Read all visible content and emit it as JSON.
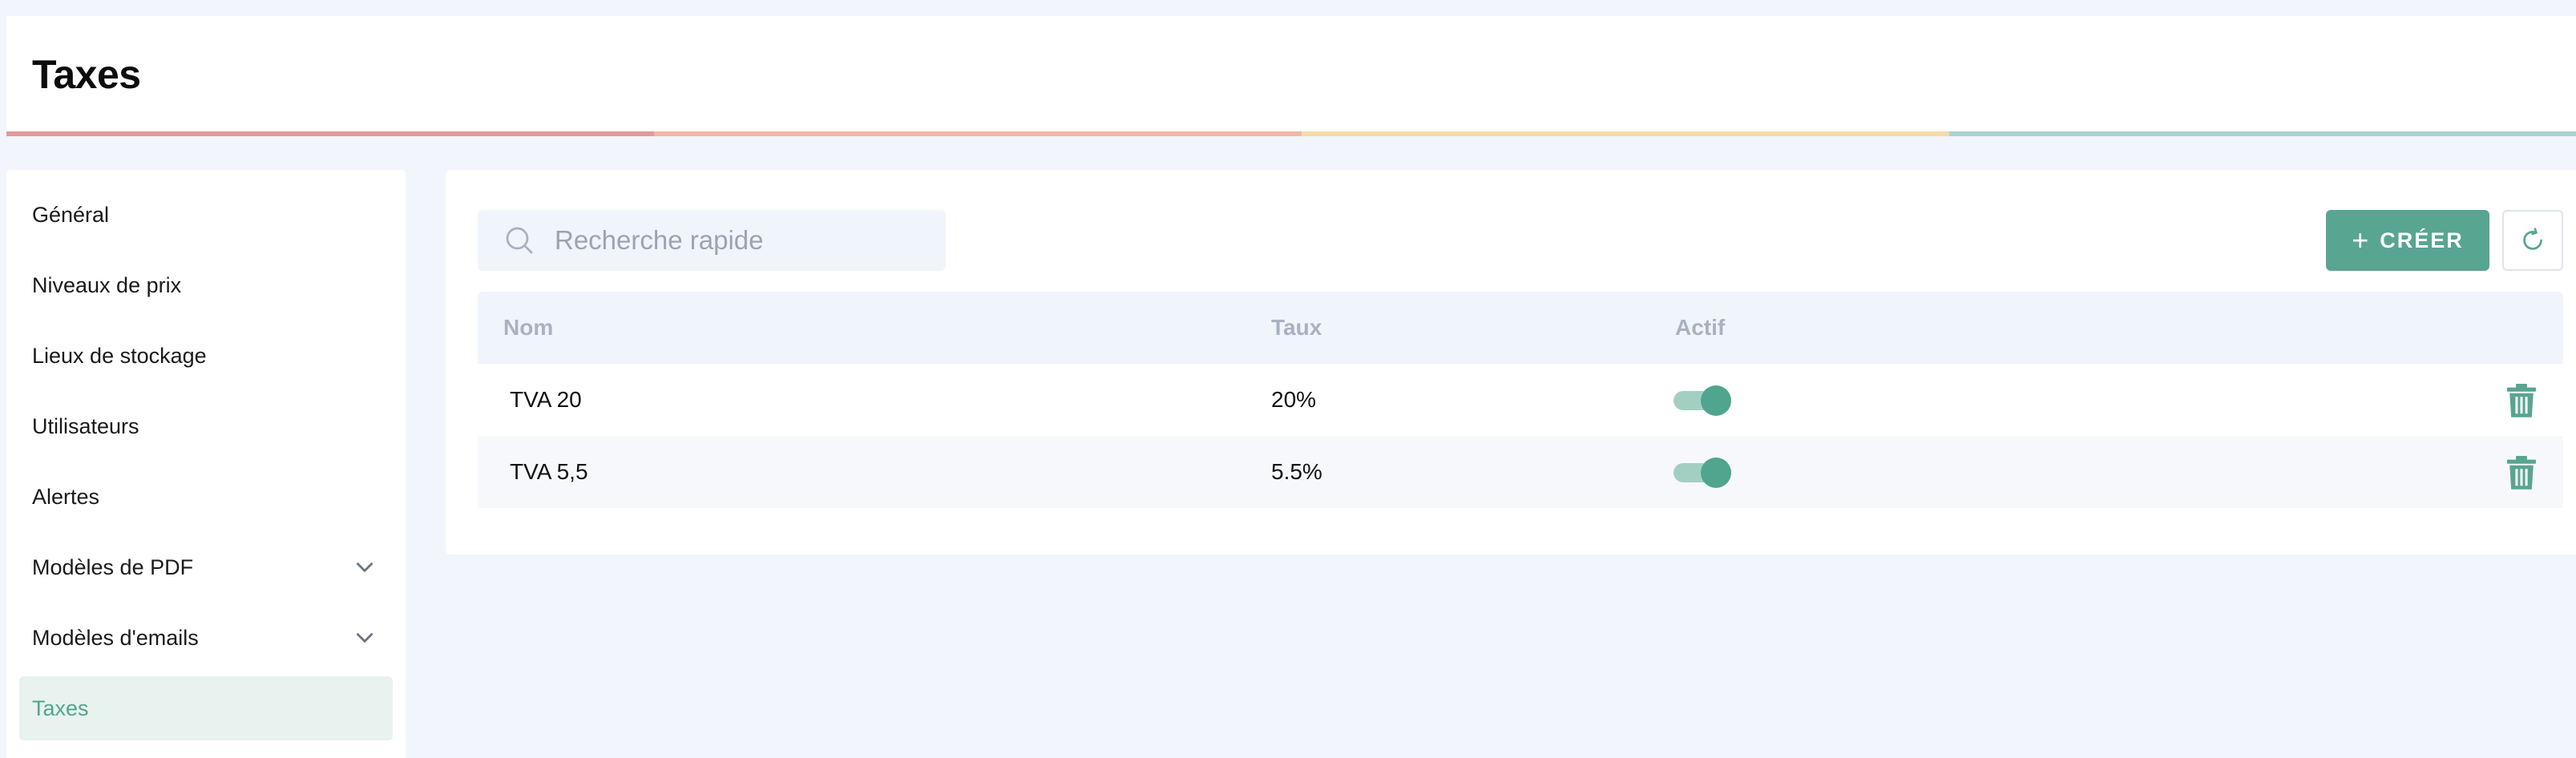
{
  "header": {
    "title": "Taxes"
  },
  "sidebar": {
    "items": [
      {
        "label": "Général"
      },
      {
        "label": "Niveaux de prix"
      },
      {
        "label": "Lieux de stockage"
      },
      {
        "label": "Utilisateurs"
      },
      {
        "label": "Alertes"
      },
      {
        "label": "Modèles de PDF",
        "expandable": true
      },
      {
        "label": "Modèles d'emails",
        "expandable": true
      },
      {
        "label": "Taxes",
        "active": true
      }
    ]
  },
  "toolbar": {
    "search_placeholder": "Recherche rapide",
    "search_icon": "search-icon",
    "create_label": "CRÉER",
    "create_icon": "plus-icon",
    "refresh_icon": "refresh-icon"
  },
  "table": {
    "columns": [
      "Nom",
      "Taux",
      "Actif"
    ],
    "rows": [
      {
        "name": "TVA 20",
        "rate": "20%",
        "active": true
      },
      {
        "name": "TVA 5,5",
        "rate": "5.5%",
        "active": true
      }
    ],
    "delete_icon": "trash-icon"
  },
  "colors": {
    "accent": "#58a592",
    "active_sidebar_bg": "#e8f2ef",
    "background": "#f2f5fb",
    "stripe": [
      "#e29a98",
      "#f1b8a6",
      "#f3dca8",
      "#abd3cd"
    ]
  }
}
